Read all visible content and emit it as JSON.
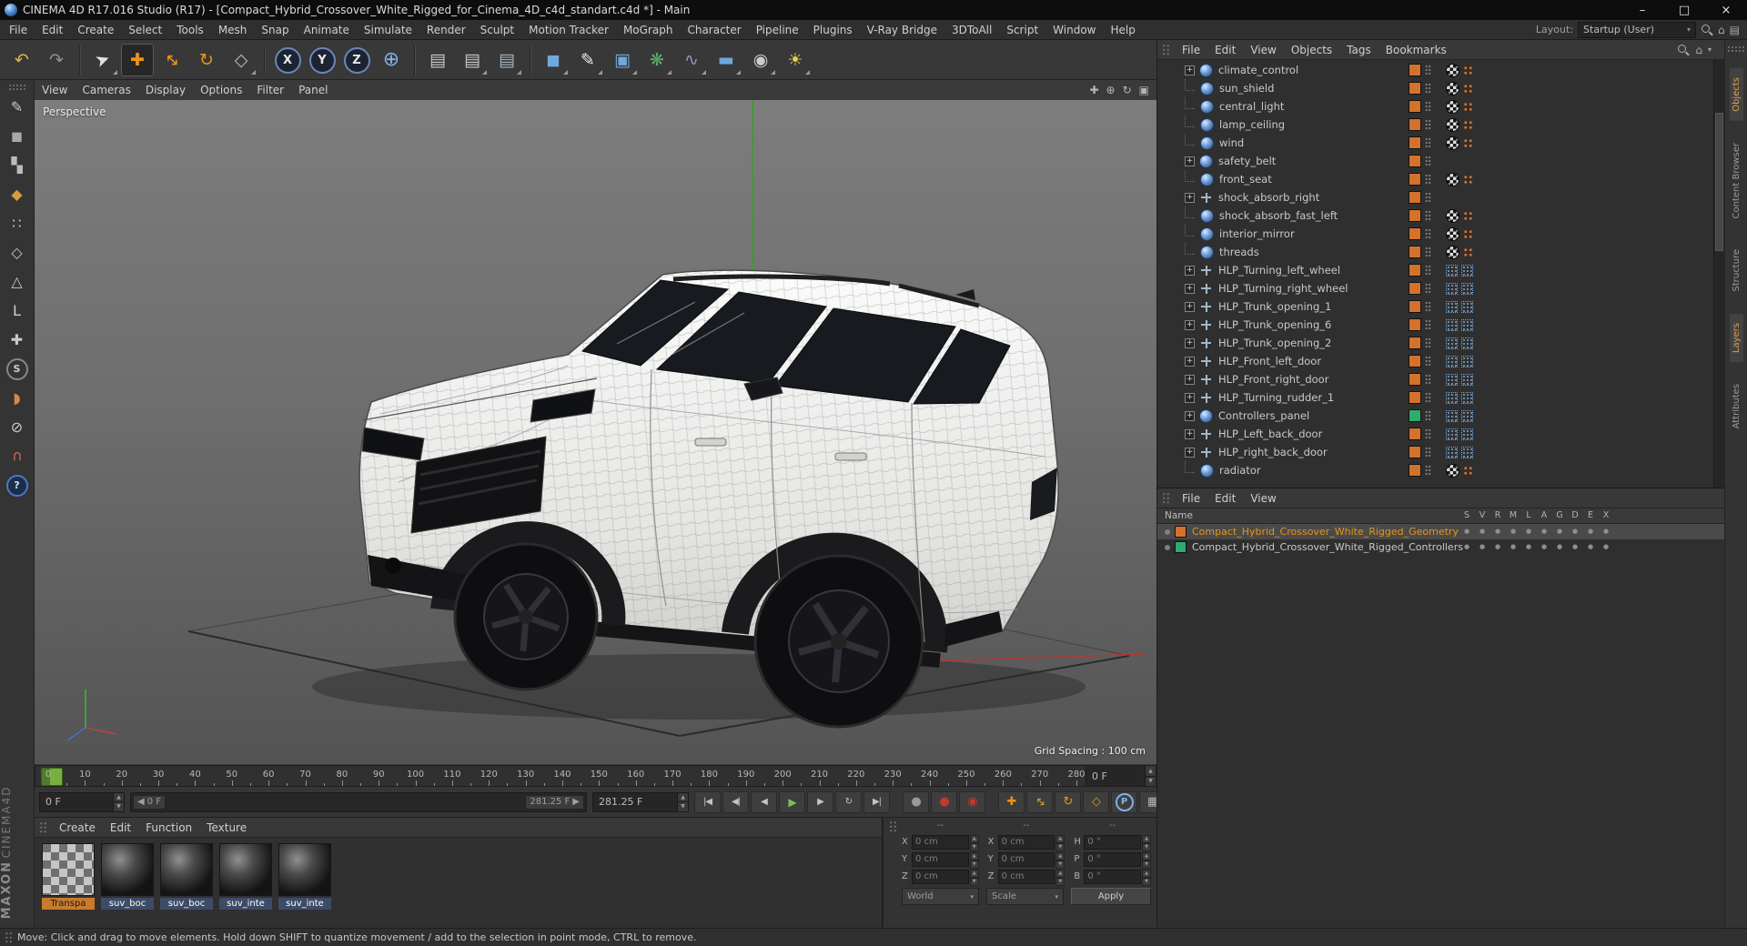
{
  "window": {
    "title": "CINEMA 4D R17.016 Studio (R17) - [Compact_Hybrid_Crossover_White_Rigged_for_Cinema_4D_c4d_standart.c4d *] - Main",
    "controls": {
      "minimize": "–",
      "maximize": "□",
      "close": "×"
    }
  },
  "menu_bar": {
    "items": [
      "File",
      "Edit",
      "Create",
      "Select",
      "Tools",
      "Mesh",
      "Snap",
      "Animate",
      "Simulate",
      "Render",
      "Sculpt",
      "Motion Tracker",
      "MoGraph",
      "Character",
      "Pipeline",
      "Plugins",
      "V-Ray Bridge",
      "3DToAll",
      "Script",
      "Window",
      "Help"
    ]
  },
  "layout": {
    "label": "Layout:",
    "value": "Startup (User)"
  },
  "toolbar": {
    "tools": [
      {
        "name": "undo-button",
        "glyph": "↶",
        "color": "#d9b34a"
      },
      {
        "name": "redo-button",
        "glyph": "↷",
        "color": "#8f8f8f",
        "sep_after": true
      },
      {
        "name": "live-selection-tool",
        "glyph": "➤",
        "color": "#e2e2e2",
        "rot20": true,
        "flyout": true
      },
      {
        "name": "move-tool",
        "glyph": "✚",
        "color": "#e8941a",
        "active": true
      },
      {
        "name": "scale-tool",
        "glyph": "↔",
        "color": "#e8941a",
        "rot45": true
      },
      {
        "name": "rotate-tool",
        "glyph": "↻",
        "color": "#e8941a"
      },
      {
        "name": "last-used-tool",
        "glyph": "◇",
        "color": "#bdbdbd",
        "flyout": true,
        "sep_after": true
      },
      {
        "name": "lock-x-axis-button",
        "glyph": "X",
        "circled": true
      },
      {
        "name": "lock-y-axis-button",
        "glyph": "Y",
        "circled": true
      },
      {
        "name": "lock-z-axis-button",
        "glyph": "Z",
        "circled": true
      },
      {
        "name": "coordinate-system-button",
        "glyph": "⊕",
        "color": "#7fb2e8",
        "big": true,
        "sep_after": true
      },
      {
        "name": "render-view-button",
        "glyph": "▤",
        "color": "#c9c9c9"
      },
      {
        "name": "render-picture-viewer-button",
        "glyph": "▤",
        "color": "#c9c9c9",
        "flyout": true
      },
      {
        "name": "render-settings-button",
        "glyph": "▤",
        "color": "#9fb6c6",
        "flyout": true,
        "sep_after": true
      },
      {
        "name": "add-cube-button",
        "glyph": "◼",
        "color": "#6fa8dc",
        "flyout": true
      },
      {
        "name": "add-spline-button",
        "glyph": "✎",
        "color": "#e8e8e8",
        "flyout": true
      },
      {
        "name": "add-subdivision-surface-button",
        "glyph": "▣",
        "color": "#6fa8dc",
        "flyout": true
      },
      {
        "name": "add-generator-button",
        "glyph": "❋",
        "color": "#58b368",
        "flyout": true
      },
      {
        "name": "add-deformer-button",
        "glyph": "∿",
        "color": "#9a8fd6",
        "flyout": true
      },
      {
        "name": "add-environment-button",
        "glyph": "▬",
        "color": "#6fa8dc",
        "flyout": true
      },
      {
        "name": "add-camera-button",
        "glyph": "◉",
        "color": "#cccccc",
        "flyout": true
      },
      {
        "name": "add-light-button",
        "glyph": "☀",
        "color": "#e8d44a",
        "flyout": true
      }
    ]
  },
  "left_palette": {
    "tools": [
      {
        "name": "make-editable-button",
        "glyph": "✎",
        "color": "#c9c9c9"
      },
      {
        "name": "model-mode-button",
        "glyph": "◼",
        "color": "#a8a8a8"
      },
      {
        "name": "texture-mode-button",
        "glyph": "▚",
        "color": "#bbbbbb"
      },
      {
        "name": "workplane-mode-button",
        "glyph": "◆",
        "color": "#d89a3c"
      },
      {
        "name": "points-mode-button",
        "glyph": "∷",
        "color": "#c9c9c9"
      },
      {
        "name": "edges-mode-button",
        "glyph": "◇",
        "color": "#c9c9c9"
      },
      {
        "name": "polygons-mode-button",
        "glyph": "△",
        "color": "#c9c9c9"
      },
      {
        "name": "axis-modification-button",
        "glyph": "L",
        "color": "#d0d0d0"
      },
      {
        "name": "enable-axis-button",
        "glyph": "✚",
        "color": "#c9c9c9"
      },
      {
        "name": "viewport-solo-button",
        "glyph": "S",
        "circled": true
      },
      {
        "name": "paint-tool-button",
        "glyph": "◗",
        "color": "#d08a4a"
      },
      {
        "name": "lock-workplane-button",
        "glyph": "⊘",
        "color": "#c9c9c9"
      },
      {
        "name": "snap-settings-button",
        "glyph": "∪",
        "color": "#cc6655",
        "rot180": true
      },
      {
        "name": "help-button",
        "glyph": "?",
        "circledBlue": true
      }
    ]
  },
  "viewport": {
    "menus": [
      "View",
      "Cameras",
      "Display",
      "Options",
      "Filter",
      "Panel"
    ],
    "view_label": "Perspective",
    "grid_spacing": "Grid Spacing : 100 cm"
  },
  "timeline": {
    "tick_start": 0,
    "tick_end": 280,
    "tick_step": 10,
    "frame_field": "0 F"
  },
  "transport": {
    "current_frame": "0 F",
    "range_start": "0 F",
    "range_end": "281.25 F",
    "end_frame": "281.25 F",
    "play_buttons": [
      {
        "name": "goto-start-button",
        "glyph": "|◀"
      },
      {
        "name": "prev-key-button",
        "glyph": "◀|"
      },
      {
        "name": "prev-frame-button",
        "glyph": "◀"
      },
      {
        "name": "play-button",
        "glyph": "▶",
        "color": "#7ec04f"
      },
      {
        "name": "next-frame-button",
        "glyph": "▶"
      },
      {
        "name": "loop-button",
        "glyph": "↻"
      },
      {
        "name": "goto-end-button",
        "glyph": "▶|"
      }
    ],
    "record_buttons": [
      {
        "name": "record-objects-button",
        "glyph": "●",
        "color": "#9a9a9a"
      },
      {
        "name": "autokey-button",
        "glyph": "●",
        "color": "#c0392b"
      },
      {
        "name": "keying-settings-button",
        "glyph": "◉",
        "color": "#c0392b"
      }
    ],
    "key_toggles": [
      {
        "name": "record-position-toggle",
        "glyph": "✚",
        "color": "#e8941a"
      },
      {
        "name": "record-scale-toggle",
        "glyph": "↔",
        "color": "#e8941a",
        "rot45": true
      },
      {
        "name": "record-rotation-toggle",
        "glyph": "↻",
        "color": "#e8941a"
      },
      {
        "name": "record-parameter-toggle",
        "glyph": "◇",
        "color": "#e8941a"
      },
      {
        "name": "record-point-level-toggle",
        "glyph": "P",
        "circledBlue": true
      },
      {
        "name": "keyframe-selection-button",
        "glyph": "▦",
        "color": "#b5b5b5"
      }
    ],
    "timeline_button": {
      "name": "timeline-window-button",
      "glyph": "≡"
    }
  },
  "object_manager": {
    "menus": [
      "File",
      "Edit",
      "View",
      "Objects",
      "Tags",
      "Bookmarks"
    ],
    "items": [
      {
        "name": "climate_control",
        "expand": true,
        "icon": "joint",
        "tag": "circle"
      },
      {
        "name": "sun_shield",
        "expand": false,
        "icon": "joint",
        "tag": "circle"
      },
      {
        "name": "central_light",
        "expand": false,
        "icon": "joint",
        "tag": "circle"
      },
      {
        "name": "lamp_ceiling",
        "expand": false,
        "icon": "joint",
        "tag": "circle"
      },
      {
        "name": "wind",
        "expand": false,
        "icon": "joint",
        "tag": "circle"
      },
      {
        "name": "safety_belt",
        "expand": true,
        "icon": "joint",
        "tag": "none"
      },
      {
        "name": "front_seat",
        "expand": false,
        "icon": "joint",
        "tag": "circle"
      },
      {
        "name": "shock_absorb_right",
        "expand": true,
        "icon": "nullobj",
        "tag": "none"
      },
      {
        "name": "shock_absorb_fast_left",
        "expand": false,
        "icon": "joint",
        "tag": "circle"
      },
      {
        "name": "interior_mirror",
        "expand": false,
        "icon": "joint",
        "tag": "circle"
      },
      {
        "name": "threads",
        "expand": false,
        "icon": "joint",
        "tag": "circle"
      },
      {
        "name": "HLP_Turning_left_wheel",
        "expand": true,
        "icon": "nullobj",
        "tag": "dots"
      },
      {
        "name": "HLP_Turning_right_wheel",
        "expand": true,
        "icon": "nullobj",
        "tag": "dots"
      },
      {
        "name": "HLP_Trunk_opening_1",
        "expand": true,
        "icon": "nullobj",
        "tag": "dots"
      },
      {
        "name": "HLP_Trunk_opening_6",
        "expand": true,
        "icon": "nullobj",
        "tag": "dots"
      },
      {
        "name": "HLP_Trunk_opening_2",
        "expand": true,
        "icon": "nullobj",
        "tag": "dots"
      },
      {
        "name": "HLP_Front_left_door",
        "expand": true,
        "icon": "nullobj",
        "tag": "dots"
      },
      {
        "name": "HLP_Front_right_door",
        "expand": true,
        "icon": "nullobj",
        "tag": "dots"
      },
      {
        "name": "HLP_Turning_rudder_1",
        "expand": true,
        "icon": "nullobj",
        "tag": "dots"
      },
      {
        "name": "Controllers_panel",
        "expand": true,
        "icon": "joint",
        "tag": "dots",
        "layer": "#2eac6d"
      },
      {
        "name": "HLP_Left_back_door",
        "expand": true,
        "icon": "nullobj",
        "tag": "dots"
      },
      {
        "name": "HLP_right_back_door",
        "expand": true,
        "icon": "nullobj",
        "tag": "dots"
      },
      {
        "name": "radiator",
        "expand": false,
        "icon": "joint",
        "tag": "circle"
      }
    ],
    "default_layer_color": "#d4722c"
  },
  "layer_manager": {
    "menus": [
      "File",
      "Edit",
      "View"
    ],
    "name_header": "Name",
    "columns": [
      "S",
      "V",
      "R",
      "M",
      "L",
      "A",
      "G",
      "D",
      "E",
      "X"
    ],
    "rows": [
      {
        "name": "Compact_Hybrid_Crossover_White_Rigged_Geometry",
        "color": "#d4722c",
        "selected": true
      },
      {
        "name": "Compact_Hybrid_Crossover_White_Rigged_Controllers",
        "color": "#2eac6d",
        "selected": false
      }
    ]
  },
  "materials": {
    "menus": [
      "Create",
      "Edit",
      "Function",
      "Texture"
    ],
    "items": [
      {
        "name": "Transpa",
        "type": "checker",
        "selected": true
      },
      {
        "name": "suv_boc",
        "type": "sphere",
        "selected": false
      },
      {
        "name": "suv_boc",
        "type": "sphere",
        "selected": false
      },
      {
        "name": "suv_inte",
        "type": "sphere",
        "selected": false
      },
      {
        "name": "suv_inte",
        "type": "sphere",
        "selected": false
      }
    ]
  },
  "coordinates": {
    "headers": [
      "--",
      "--",
      "--"
    ],
    "groups": [
      {
        "rows": [
          {
            "label": "X",
            "value": "0 cm"
          },
          {
            "label": "Y",
            "value": "0 cm"
          },
          {
            "label": "Z",
            "value": "0 cm"
          }
        ]
      },
      {
        "rows": [
          {
            "label": "X",
            "value": "0 cm"
          },
          {
            "label": "Y",
            "value": "0 cm"
          },
          {
            "label": "Z",
            "value": "0 cm"
          }
        ]
      },
      {
        "rows": [
          {
            "label": "H",
            "value": "0 °"
          },
          {
            "label": "P",
            "value": "0 °"
          },
          {
            "label": "B",
            "value": "0 °"
          }
        ]
      }
    ],
    "dropdowns": [
      "World",
      "Scale"
    ],
    "apply_label": "Apply"
  },
  "side_tabs": {
    "items": [
      {
        "label": "Objects",
        "active": true
      },
      {
        "label": "Content Browser",
        "active": false
      },
      {
        "label": "Structure",
        "active": false
      },
      {
        "label": "Layers",
        "active": true
      },
      {
        "label": "Attributes",
        "active": false
      }
    ]
  },
  "status_bar": {
    "text": "Move: Click and drag to move elements. Hold down SHIFT to quantize movement / add to the selection in point mode, CTRL to remove."
  },
  "branding": {
    "line1": "MAXON",
    "line2": "CINEMA4D"
  }
}
